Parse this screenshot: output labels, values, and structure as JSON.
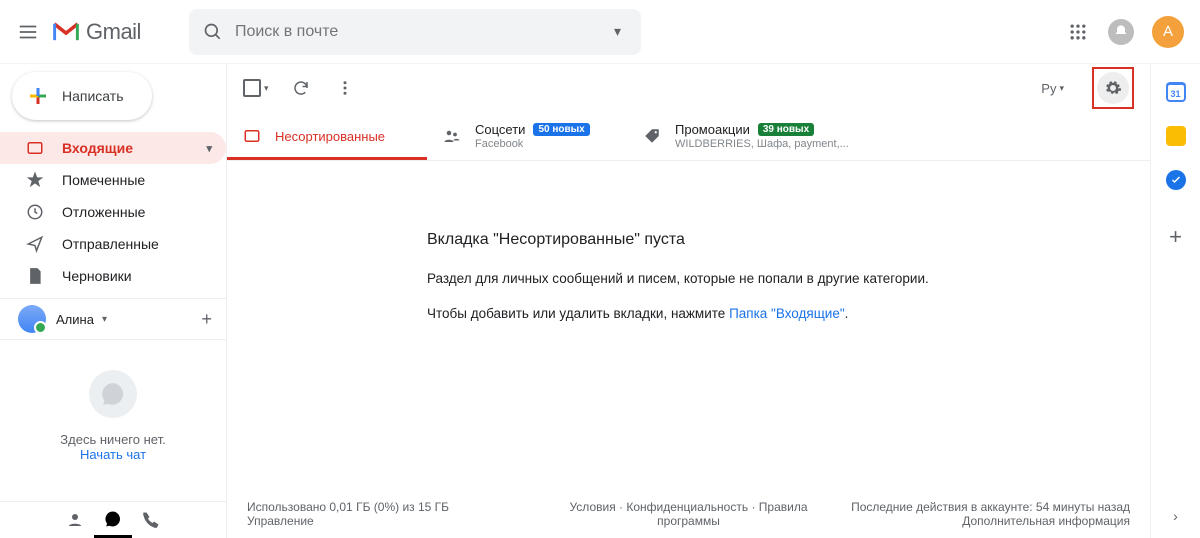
{
  "header": {
    "product": "Gmail",
    "search_placeholder": "Поиск в почте",
    "avatar_initial": "А"
  },
  "compose_label": "Написать",
  "sidebar": {
    "items": [
      {
        "label": "Входящие"
      },
      {
        "label": "Помеченные"
      },
      {
        "label": "Отложенные"
      },
      {
        "label": "Отправленные"
      },
      {
        "label": "Черновики"
      }
    ]
  },
  "hangouts": {
    "user": "Алина",
    "empty_text": "Здесь ничего нет.",
    "start_chat": "Начать чат"
  },
  "toolbar": {
    "lang": "Ру"
  },
  "tabs": [
    {
      "label": "Несортированные"
    },
    {
      "label": "Соцсети",
      "badge": "50 новых",
      "sub": "Facebook"
    },
    {
      "label": "Промоакции",
      "badge": "39 новых",
      "sub": "WILDBERRIES, Шафа, payment,..."
    }
  ],
  "empty": {
    "title": "Вкладка \"Несортированные\" пуста",
    "p1": "Раздел для личных сообщений и писем, которые не попали в другие категории.",
    "p2a": "Чтобы добавить или удалить вкладки, нажмите ",
    "p2link": "Папка \"Входящие\"",
    "p2b": "."
  },
  "footer": {
    "storage_line": "Использовано 0,01 ГБ (0%) из 15 ГБ",
    "manage": "Управление",
    "terms": "Условия",
    "privacy": "Конфиденциальность",
    "policies": "Правила программы",
    "activity": "Последние действия в аккаунте: 54 минуты назад",
    "details": "Дополнительная информация"
  },
  "sidepanel": {
    "calendar_day": "31"
  }
}
